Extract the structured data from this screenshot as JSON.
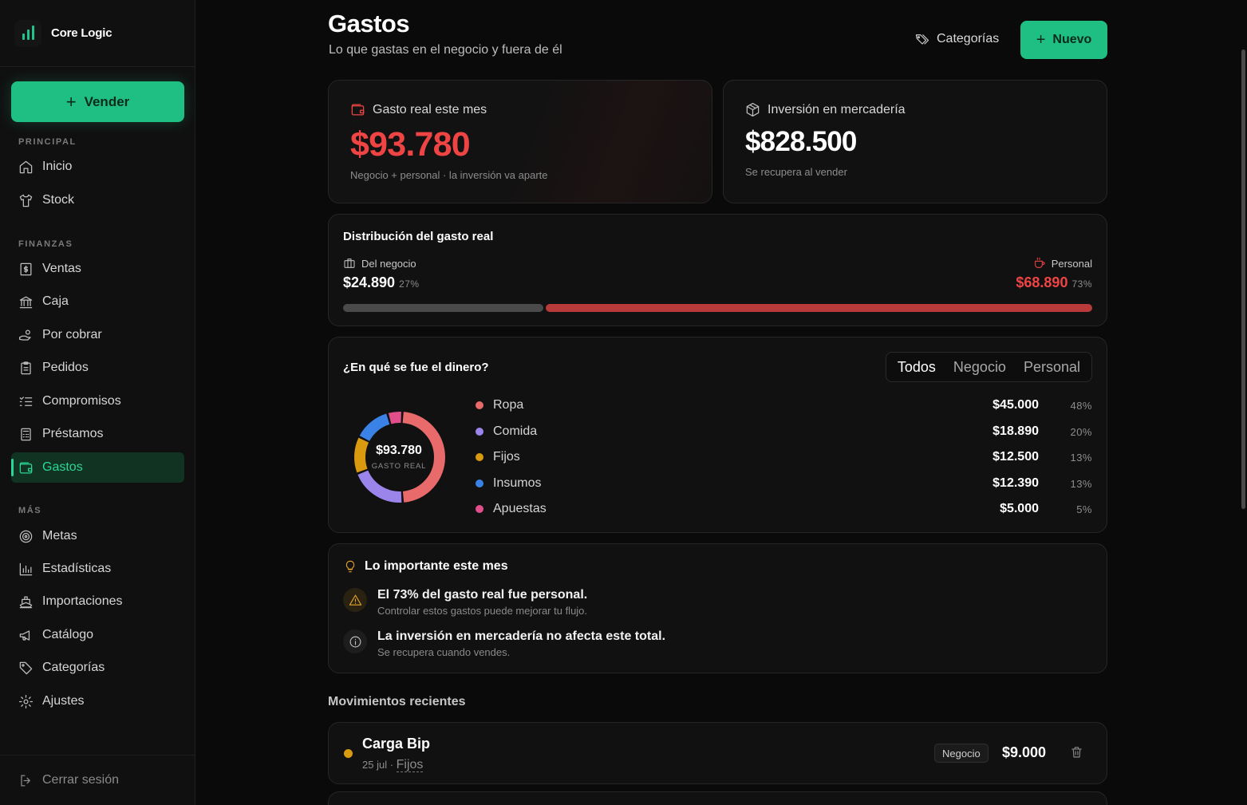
{
  "app": {
    "brand": "Core Logic"
  },
  "sidebar": {
    "sell_label": "Vender",
    "sections": [
      "PRINCIPAL",
      "FINANZAS",
      "MÁS"
    ],
    "items": [
      {
        "label": "Inicio",
        "icon": "home-icon"
      },
      {
        "label": "Stock",
        "icon": "shirt-icon"
      },
      {
        "label": "Ventas",
        "icon": "receipt-icon"
      },
      {
        "label": "Caja",
        "icon": "bank-icon"
      },
      {
        "label": "Por cobrar",
        "icon": "hand-coins-icon"
      },
      {
        "label": "Pedidos",
        "icon": "clipboard-icon"
      },
      {
        "label": "Compromisos",
        "icon": "list-check-icon"
      },
      {
        "label": "Préstamos",
        "icon": "calculator-icon"
      },
      {
        "label": "Gastos",
        "icon": "wallet-icon",
        "active": true
      },
      {
        "label": "Metas",
        "icon": "target-icon"
      },
      {
        "label": "Estadísticas",
        "icon": "bar-chart-icon"
      },
      {
        "label": "Importaciones",
        "icon": "ship-icon"
      },
      {
        "label": "Catálogo",
        "icon": "megaphone-icon"
      },
      {
        "label": "Categorías",
        "icon": "tag-icon"
      },
      {
        "label": "Ajustes",
        "icon": "gear-icon"
      }
    ],
    "logout_label": "Cerrar sesión"
  },
  "header": {
    "title": "Gastos",
    "subtitle": "Lo que gastas en el negocio y fuera de él",
    "categories_label": "Categorías",
    "new_label": "Nuevo"
  },
  "kpis": {
    "real": {
      "label": "Gasto real este mes",
      "value": "$93.780",
      "note": "Negocio + personal · la inversión va aparte"
    },
    "invest": {
      "label": "Inversión en mercadería",
      "value": "$828.500",
      "note": "Se recupera al vender"
    }
  },
  "distribution": {
    "title": "Distribución del gasto real",
    "business": {
      "label": "Del negocio",
      "value": "$24.890",
      "pct": "27%",
      "share": 27
    },
    "personal": {
      "label": "Personal",
      "value": "$68.890",
      "pct": "73%",
      "share": 73
    }
  },
  "where": {
    "title": "¿En qué se fue el dinero?",
    "filters": [
      "Todos",
      "Negocio",
      "Personal"
    ],
    "active_filter": "Todos",
    "donut_total": "$93.780",
    "donut_caption": "GASTO REAL"
  },
  "chart_data": {
    "type": "pie",
    "categories": [
      "Ropa",
      "Comida",
      "Fijos",
      "Insumos",
      "Apuestas"
    ],
    "values": [
      45000,
      18890,
      12500,
      12390,
      5000
    ],
    "amount_labels": [
      "$45.000",
      "$18.890",
      "$12.500",
      "$12.390",
      "$5.000"
    ],
    "percent_labels": [
      "48%",
      "20%",
      "13%",
      "13%",
      "5%"
    ],
    "colors": [
      "#e86a6a",
      "#9b85ea",
      "#d99a10",
      "#3b82e6",
      "#e04f8a"
    ]
  },
  "insights": {
    "title": "Lo importante este mes",
    "items": [
      {
        "main": "El 73% del gasto real fue personal.",
        "sub": "Controlar estos gastos puede mejorar tu flujo.",
        "icon": "warning-icon"
      },
      {
        "main": "La inversión en mercadería no afecta este total.",
        "sub": "Se recupera cuando vendes.",
        "icon": "info-icon"
      }
    ]
  },
  "recent": {
    "title": "Movimientos recientes",
    "items": [
      {
        "name": "Carga Bip",
        "date": "25 jul",
        "category": "Fijos",
        "badge": "Negocio",
        "amount": "$9.000",
        "dot_color": "#d99a10"
      }
    ]
  },
  "colors": {
    "accent": "#1fbf84",
    "danger": "#ef4444",
    "bar_personal": "#b83a3a",
    "bar_business": "#4a4a4a"
  }
}
